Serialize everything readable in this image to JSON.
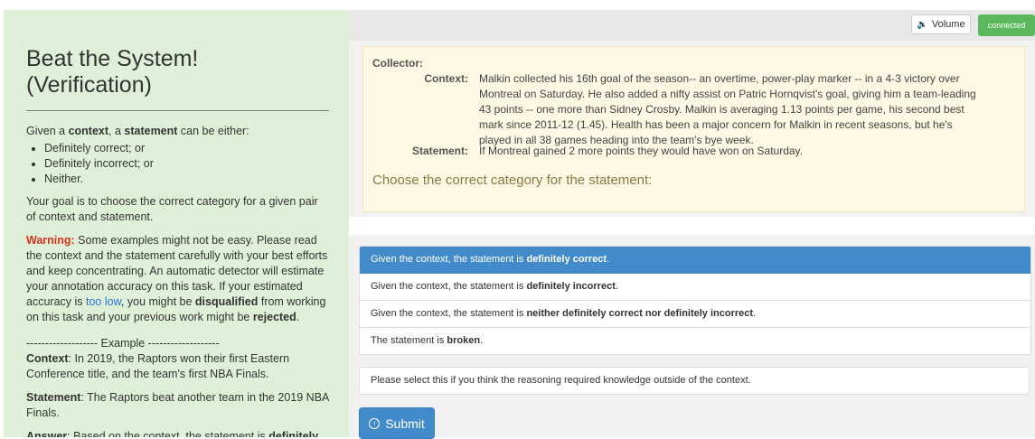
{
  "instructions": {
    "title_line1": "Beat the System!",
    "title_line2": "(Verification)",
    "intro_pre": "Given a ",
    "intro_context": "context",
    "intro_mid": ", a ",
    "intro_statement": "statement",
    "intro_post": " can be either:",
    "bullets": [
      "Definitely correct; or",
      "Definitely incorrect; or",
      "Neither."
    ],
    "goal": "Your goal is to choose the correct category for a given pair of context and statement.",
    "warning_label": "Warning:",
    "warning_text1": " Some examples might not be easy. Please read the context and the statement carefully with your best efforts and keep concentrating. An automatic detector will estimate your annotation accuracy on this task. If your estimated accuracy is ",
    "warning_link": "too low",
    "warning_text2": ", you might be ",
    "warning_disq": "disqualified",
    "warning_text3": " from working on this task and your previous work might be ",
    "warning_rejected": "rejected",
    "warning_end": ".",
    "example_header": "------------------- Example -------------------",
    "ex_context_label": "Context",
    "ex_context": ": In 2019, the Raptors won their first Eastern Conference title, and the team's first NBA Finals.",
    "ex_statement_label": "Statement",
    "ex_statement": ": The Raptors beat another team in the 2019 NBA Finals.",
    "ex_answer_label": "Answer",
    "ex_answer": ": Based on the context, the statement is ",
    "ex_answer_bold": "definitely correct"
  },
  "toolbar": {
    "volume_label": "Volume",
    "connection_status": "connected"
  },
  "task": {
    "collector_label": "Collector:",
    "context_label": "Context:",
    "context_text": "Malkin collected his 16th goal of the season-- an overtime, power-play marker -- in a 4-3 victory over Montreal on Saturday. He also added a nifty assist on Patric Hornqvist's goal, giving him a team-leading 43 points -- one more than Sidney Crosby. Malkin is averaging 1.13 points per game, his second best mark since 2011-12 (1.45). Health has been a major concern for Malkin in recent seasons, but he's played in all 38 games heading into the team's bye week.",
    "statement_label": "Statement:",
    "statement_text": "If Montreal gained 2 more points they would have won on Saturday.",
    "prompt": "Choose the correct category for the statement:"
  },
  "options": [
    {
      "pre": "Given the context, the statement is ",
      "bold": "definitely correct",
      "post": "."
    },
    {
      "pre": "Given the context, the statement is ",
      "bold": "definitely incorrect",
      "post": "."
    },
    {
      "pre": "Given the context, the statement is ",
      "bold": "neither definitely correct nor definitely incorrect",
      "post": "."
    },
    {
      "pre": "The statement is ",
      "bold": "broken",
      "post": "."
    }
  ],
  "extra_option": "Please select this if you think the reasoning required knowledge outside of the context.",
  "submit_label": "Submit",
  "colors": {
    "left_panel_bg": "#dff0d8",
    "task_panel_bg": "#fcf8e3",
    "active_option": "#428bca",
    "connected_badge": "#5cb85c",
    "warning": "#d9331f"
  }
}
